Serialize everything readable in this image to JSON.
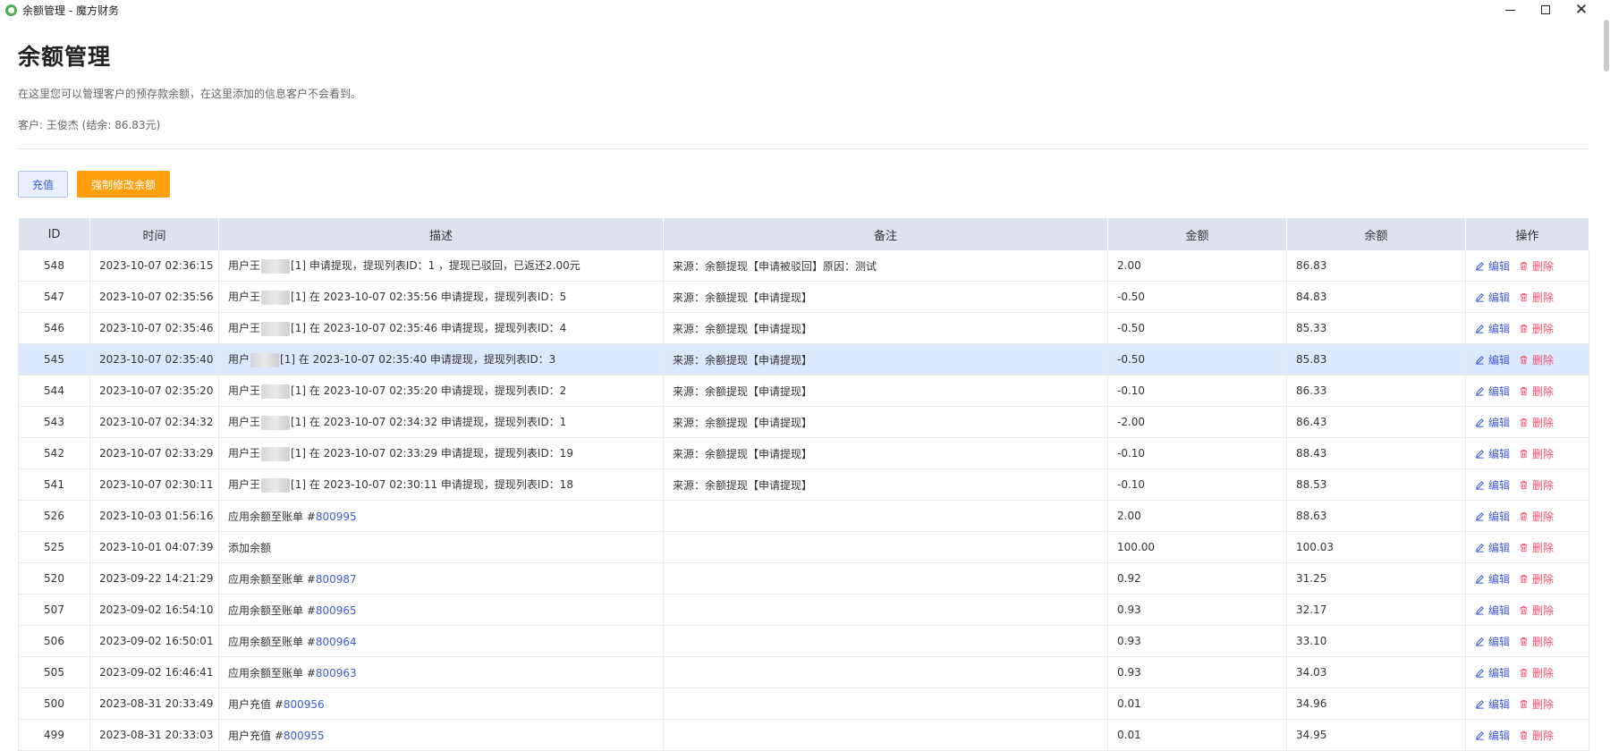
{
  "window": {
    "title": "余额管理 - 魔方财务"
  },
  "page": {
    "title": "余额管理",
    "description": "在这里您可以管理客户的预存款余额，在这里添加的信息客户不会看到。",
    "customer": "客户: 王俊杰 (结余: 86.83元)"
  },
  "toolbar": {
    "recharge_label": "充值",
    "force_label": "强制修改余额"
  },
  "table": {
    "headers": [
      "ID",
      "时间",
      "描述",
      "备注",
      "金额",
      "余额",
      "操作"
    ],
    "edit_label": "编辑",
    "delete_label": "删除",
    "rows": [
      {
        "id": "548",
        "time": "2023-10-07 02:36:15",
        "desc_pre": "用户王",
        "desc_blur": true,
        "desc_post": "[1] 申请提现，提现列表ID：1 ，提现已驳回，已返还2.00元",
        "desc_link": "",
        "note": "来源：余额提现【申请被驳回】原因：测试",
        "amount": "2.00",
        "balance": "86.83",
        "selected": false
      },
      {
        "id": "547",
        "time": "2023-10-07 02:35:56",
        "desc_pre": "用户王",
        "desc_blur": true,
        "desc_post": "[1] 在 2023-10-07 02:35:56 申请提现，提现列表ID：5",
        "desc_link": "",
        "note": "来源：余额提现【申请提现】",
        "amount": "-0.50",
        "balance": "84.83",
        "selected": false
      },
      {
        "id": "546",
        "time": "2023-10-07 02:35:46",
        "desc_pre": "用户王",
        "desc_blur": true,
        "desc_post": "[1] 在 2023-10-07 02:35:46 申请提现，提现列表ID：4",
        "desc_link": "",
        "note": "来源：余额提现【申请提现】",
        "amount": "-0.50",
        "balance": "85.33",
        "selected": false
      },
      {
        "id": "545",
        "time": "2023-10-07 02:35:40",
        "desc_pre": "用户",
        "desc_blur": true,
        "desc_post": "[1] 在 2023-10-07 02:35:40 申请提现，提现列表ID：3",
        "desc_link": "",
        "note": "来源：余额提现【申请提现】",
        "amount": "-0.50",
        "balance": "85.83",
        "selected": true
      },
      {
        "id": "544",
        "time": "2023-10-07 02:35:20",
        "desc_pre": "用户王",
        "desc_blur": true,
        "desc_post": "[1] 在 2023-10-07 02:35:20 申请提现，提现列表ID：2",
        "desc_link": "",
        "note": "来源：余额提现【申请提现】",
        "amount": "-0.10",
        "balance": "86.33",
        "selected": false
      },
      {
        "id": "543",
        "time": "2023-10-07 02:34:32",
        "desc_pre": "用户王",
        "desc_blur": true,
        "desc_post": "[1] 在 2023-10-07 02:34:32 申请提现，提现列表ID：1",
        "desc_link": "",
        "note": "来源：余额提现【申请提现】",
        "amount": "-2.00",
        "balance": "86.43",
        "selected": false
      },
      {
        "id": "542",
        "time": "2023-10-07 02:33:29",
        "desc_pre": "用户王",
        "desc_blur": true,
        "desc_post": "[1] 在 2023-10-07 02:33:29 申请提现，提现列表ID：19",
        "desc_link": "",
        "note": "来源：余额提现【申请提现】",
        "amount": "-0.10",
        "balance": "88.43",
        "selected": false
      },
      {
        "id": "541",
        "time": "2023-10-07 02:30:11",
        "desc_pre": "用户王",
        "desc_blur": true,
        "desc_post": "[1] 在 2023-10-07 02:30:11 申请提现，提现列表ID：18",
        "desc_link": "",
        "note": "来源：余额提现【申请提现】",
        "amount": "-0.10",
        "balance": "88.53",
        "selected": false
      },
      {
        "id": "526",
        "time": "2023-10-03 01:56:16",
        "desc_pre": "应用余额至账单 #",
        "desc_blur": false,
        "desc_post": "",
        "desc_link": "800995",
        "note": "",
        "amount": "2.00",
        "balance": "88.63",
        "selected": false
      },
      {
        "id": "525",
        "time": "2023-10-01 04:07:39",
        "desc_pre": "添加余额",
        "desc_blur": false,
        "desc_post": "",
        "desc_link": "",
        "note": "",
        "amount": "100.00",
        "balance": "100.03",
        "selected": false
      },
      {
        "id": "520",
        "time": "2023-09-22 14:21:29",
        "desc_pre": "应用余额至账单 #",
        "desc_blur": false,
        "desc_post": "",
        "desc_link": "800987",
        "note": "",
        "amount": "0.92",
        "balance": "31.25",
        "selected": false
      },
      {
        "id": "507",
        "time": "2023-09-02 16:54:10",
        "desc_pre": "应用余额至账单 #",
        "desc_blur": false,
        "desc_post": "",
        "desc_link": "800965",
        "note": "",
        "amount": "0.93",
        "balance": "32.17",
        "selected": false
      },
      {
        "id": "506",
        "time": "2023-09-02 16:50:01",
        "desc_pre": "应用余额至账单 #",
        "desc_blur": false,
        "desc_post": "",
        "desc_link": "800964",
        "note": "",
        "amount": "0.93",
        "balance": "33.10",
        "selected": false
      },
      {
        "id": "505",
        "time": "2023-09-02 16:46:41",
        "desc_pre": "应用余额至账单 #",
        "desc_blur": false,
        "desc_post": "",
        "desc_link": "800963",
        "note": "",
        "amount": "0.93",
        "balance": "34.03",
        "selected": false
      },
      {
        "id": "500",
        "time": "2023-08-31 20:33:49",
        "desc_pre": "用户充值 #",
        "desc_blur": false,
        "desc_post": "",
        "desc_link": "800956",
        "note": "",
        "amount": "0.01",
        "balance": "34.96",
        "selected": false
      },
      {
        "id": "499",
        "time": "2023-08-31 20:33:03",
        "desc_pre": "用户充值 #",
        "desc_blur": false,
        "desc_post": "",
        "desc_link": "800955",
        "note": "",
        "amount": "0.01",
        "balance": "34.95",
        "selected": false
      }
    ]
  },
  "colors": {
    "accent": "#3b5bdb",
    "warning": "#ff9f0e",
    "danger": "#f0506e",
    "header_bg": "#dde3ee",
    "selected_row": "#dbe8fd"
  },
  "icons": {
    "edit": "pencil-icon",
    "delete": "trash-icon",
    "app": "app-logo-icon"
  }
}
